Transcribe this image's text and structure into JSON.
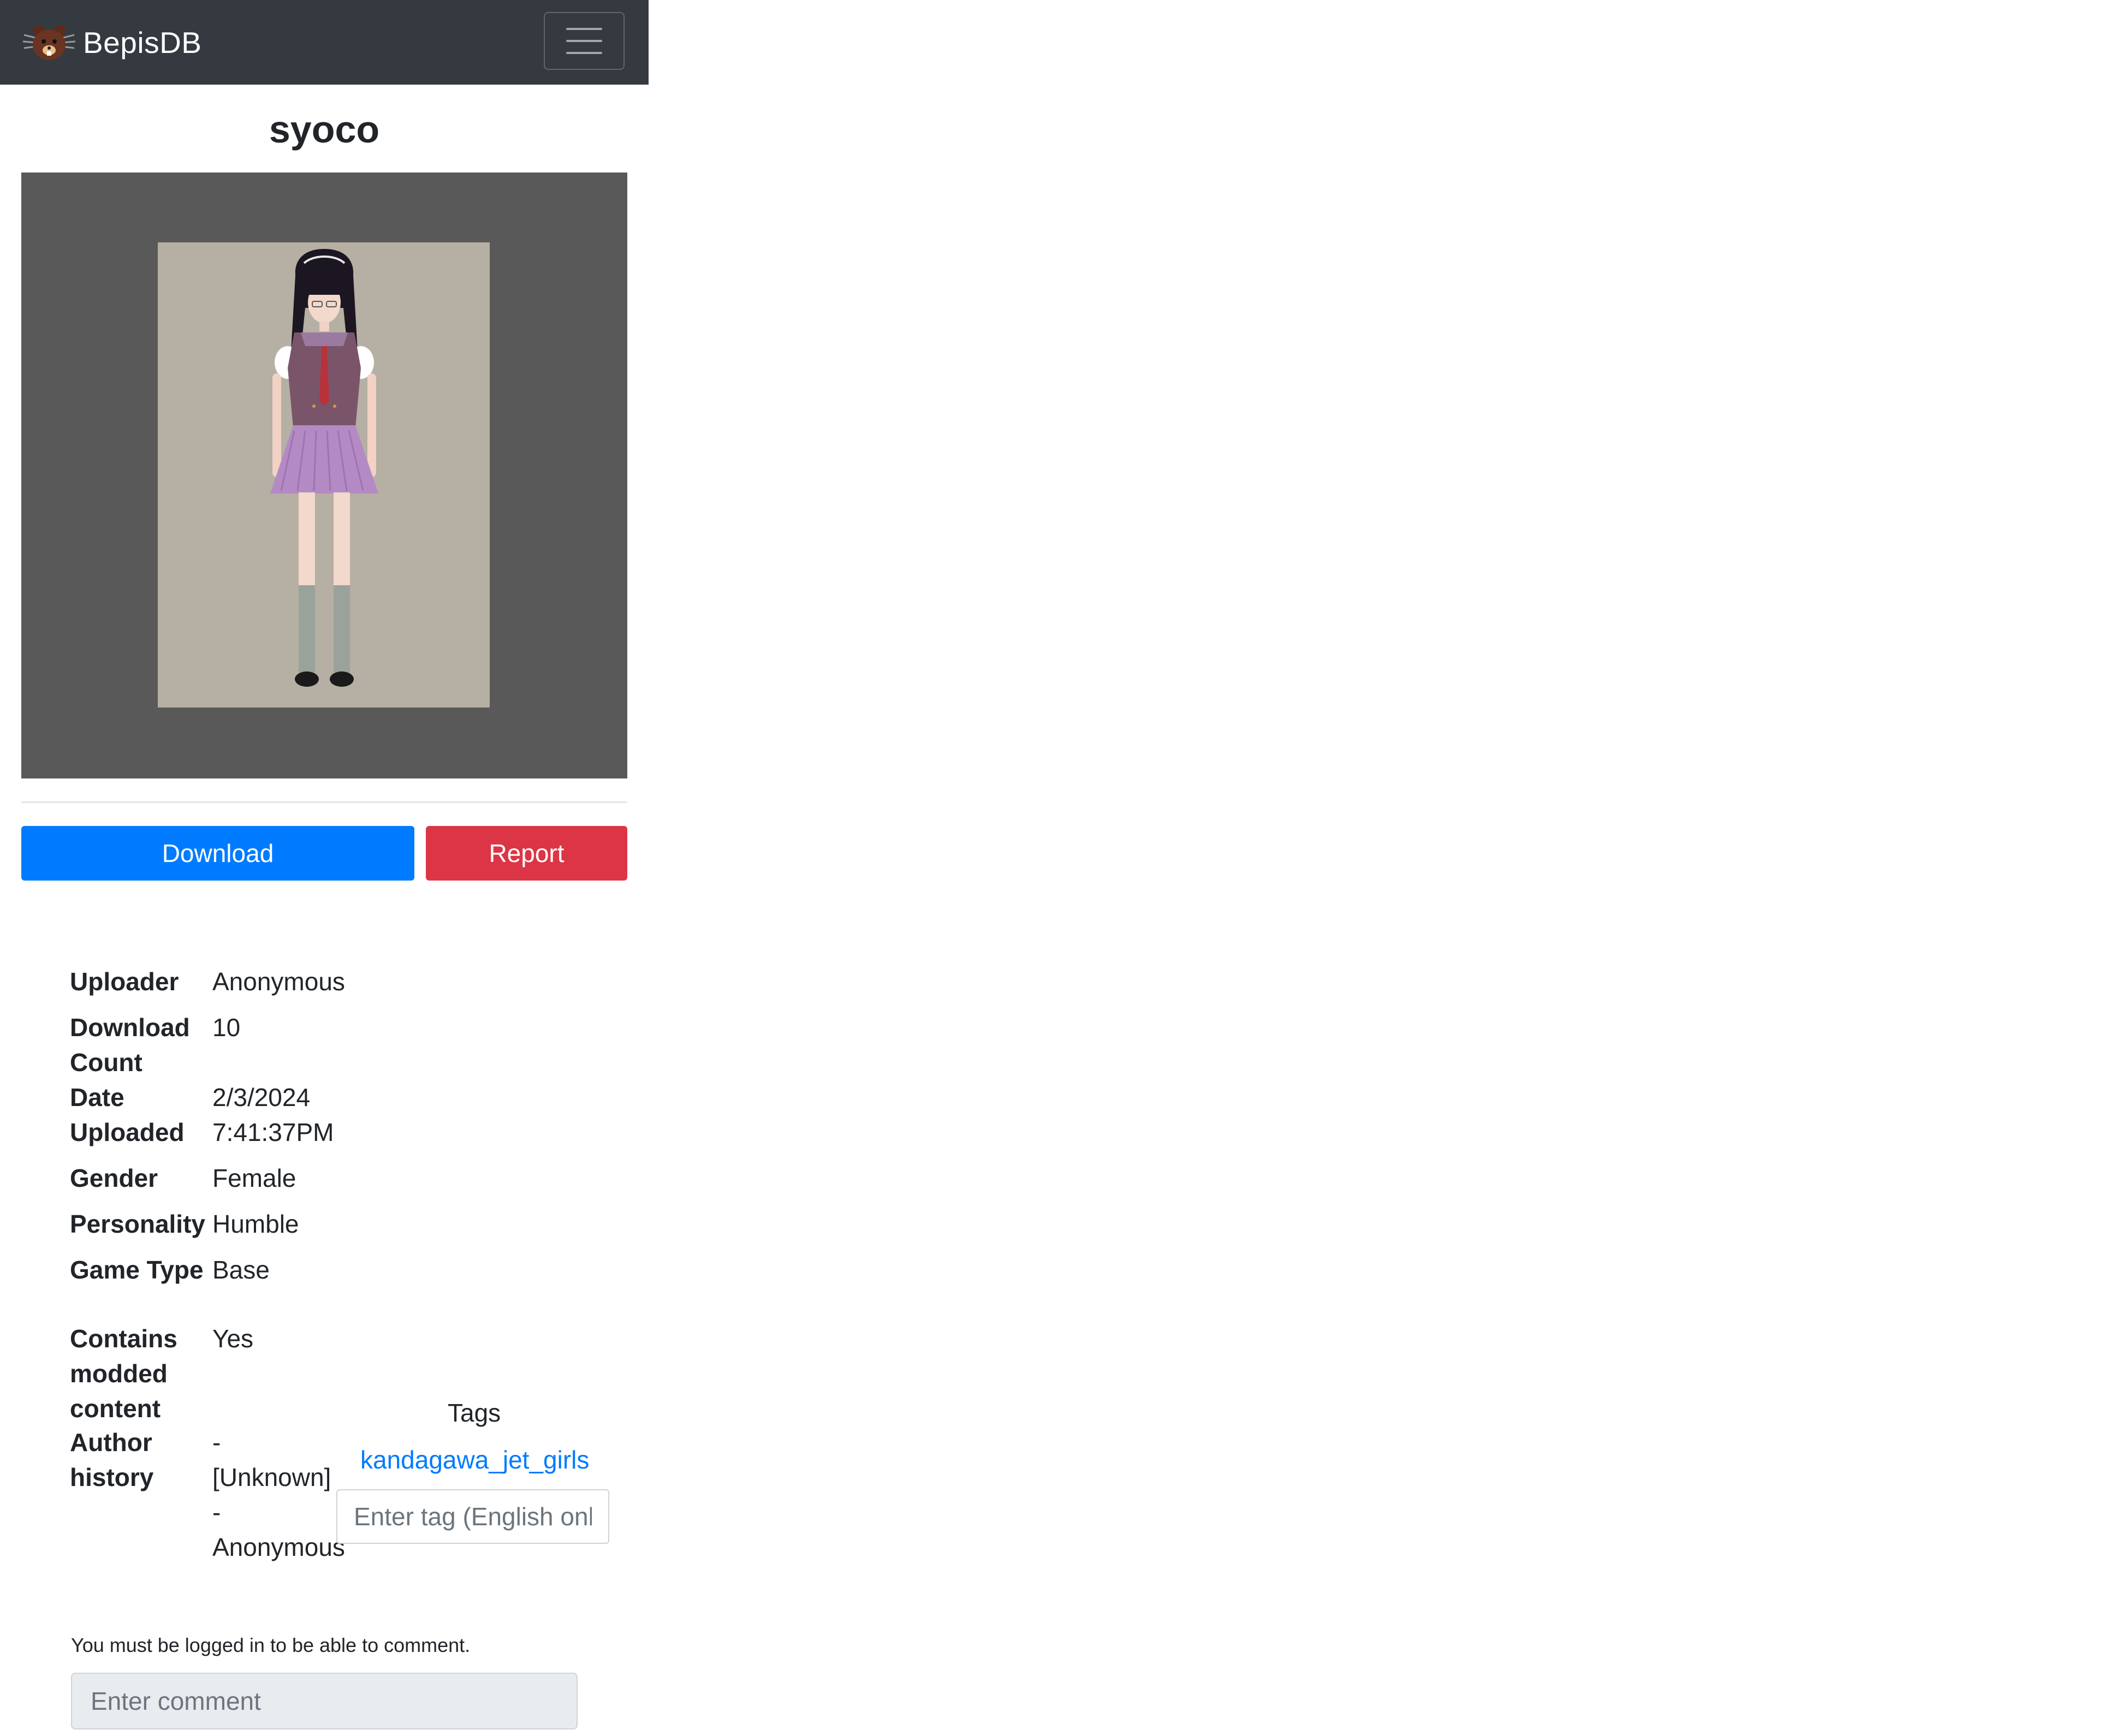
{
  "app": {
    "brand": "BepisDB",
    "logo_icon": "bear-face-icon",
    "menu_icon": "hamburger-menu-icon",
    "navbar_color": "#343a40"
  },
  "card": {
    "title": "syoco",
    "image_alt": "character card preview"
  },
  "actions": {
    "download_label": "Download",
    "report_label": "Report",
    "download_color": "#007bff",
    "report_color": "#dc3545"
  },
  "info": {
    "rows": [
      {
        "label": "Uploader",
        "value": "Anonymous"
      },
      {
        "label": "Download Count",
        "value": "10"
      },
      {
        "label": "Date Uploaded",
        "value": "2/3/2024 7:41:37PM"
      },
      {
        "label": "Gender",
        "value": "Female"
      },
      {
        "label": "Personality",
        "value": "Humble"
      },
      {
        "label": "Game Type",
        "value": "Base"
      },
      {
        "label": "Contains modded content",
        "value": "Yes"
      },
      {
        "label": "Author history",
        "value": "- [Unknown] - Anonymous"
      }
    ]
  },
  "tags": {
    "heading": "Tags",
    "items": [
      "kandagawa_jet_girls"
    ],
    "input_placeholder": "Enter tag (English only)"
  },
  "comments": {
    "login_notice": "You must be logged in to be able to comment.",
    "input_placeholder": "Enter comment"
  }
}
